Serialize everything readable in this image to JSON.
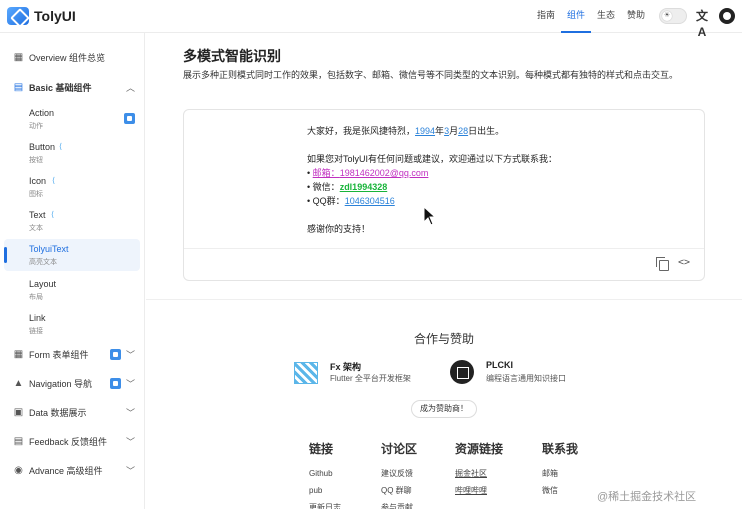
{
  "header": {
    "brand": "TolyUI",
    "nav": [
      "指南",
      "组件",
      "生态",
      "赞助"
    ],
    "active_nav": "组件",
    "theme_icon": "sun-icon",
    "lang_glyph": "文A",
    "github_icon": "github-icon"
  },
  "sidebar": {
    "overview": "Overview 组件总览",
    "basic": "Basic 基础组件",
    "items": [
      {
        "title": "Action",
        "sub": "动作"
      },
      {
        "title": "Button",
        "sub": "按钮"
      },
      {
        "title": "Icon",
        "sub": "图标"
      },
      {
        "title": "Text",
        "sub": "文本"
      },
      {
        "title": "TolyuiText",
        "sub": "高亮文本"
      },
      {
        "title": "Layout",
        "sub": "布局"
      },
      {
        "title": "Link",
        "sub": "链接"
      }
    ],
    "groups": [
      "Form 表单组件",
      "Navigation 导航",
      "Data 数据展示",
      "Feedback 反馈组件",
      "Advance 高级组件"
    ],
    "flutter_glyph": "⟨"
  },
  "main": {
    "title": "多模式智能识别",
    "description": "展示多种正则模式同时工作的效果，包括数字、邮箱、微信号等不同类型的文本识别。每种模式都有独特的样式和点击交互。",
    "demo": {
      "line1_pre": "大家好，我是张风捷特烈，",
      "year": "1994",
      "year_unit": "年",
      "month": "3",
      "month_unit": "月",
      "day": "28",
      "line1_post": "日出生。",
      "line2": "如果您对TolyUI有任何问题或建议，欢迎通过以下方式联系我：",
      "bullet": "•",
      "email_label": "邮箱：",
      "email": "1981462002@qq.com",
      "wechat_label": "微信：",
      "wechat": "zdl1994328",
      "qq_label": "QQ群：",
      "qq": "1046304516",
      "thanks": "感谢你的支持！"
    }
  },
  "sponsors": {
    "title": "合作与赞助",
    "list": [
      {
        "name": "Fx 架构",
        "desc": "Flutter 全平台开发框架"
      },
      {
        "name": "PLCKI",
        "desc": "编程语言通用知识接口"
      }
    ],
    "become": "成为赞助商！"
  },
  "footer": {
    "columns": [
      {
        "heading": "链接",
        "links": [
          "Github",
          "pub",
          "更新日志"
        ]
      },
      {
        "heading": "讨论区",
        "links": [
          "建议反馈",
          "QQ 群聊",
          "参与贡献"
        ]
      },
      {
        "heading": "资源链接",
        "links": [
          "掘金社区",
          "哔哩哔哩"
        ]
      },
      {
        "heading": "联系我",
        "links": [
          "邮箱",
          "微信"
        ]
      }
    ]
  },
  "watermark": "@稀土掘金技术社区",
  "colors": {
    "accent": "#1f6fe0",
    "email": "#c02fc0",
    "wechat": "#18b43a",
    "number": "#2b82d9"
  }
}
